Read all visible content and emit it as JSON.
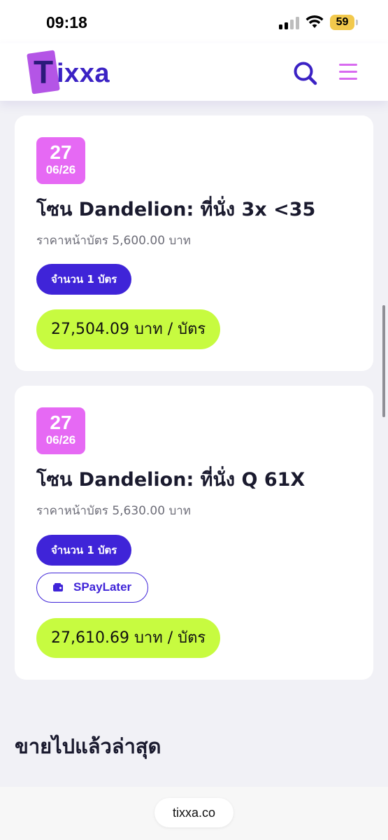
{
  "status_bar": {
    "time": "09:18",
    "battery": "59"
  },
  "header": {
    "logo_letter": "T",
    "logo_rest": "ixxa",
    "brand_colors": {
      "primary": "#3b22c4",
      "accent": "#d86bf0"
    }
  },
  "listings": [
    {
      "date_day": "27",
      "date_md": "06/26",
      "title": "โซน Dandelion: ที่นั่ง 3x <35",
      "face_price": "ราคาหน้าบัตร 5,600.00 บาท",
      "quantity": "จำนวน 1 บัตร",
      "price": "27,504.09 บาท / บัตร"
    },
    {
      "date_day": "27",
      "date_md": "06/26",
      "title": "โซน Dandelion: ที่นั่ง Q 61X",
      "face_price": "ราคาหน้าบัตร 5,630.00 บาท",
      "quantity": "จำนวน 1 บัตร",
      "paylater": "SPayLater",
      "price": "27,610.69 บาท / บัตร"
    }
  ],
  "section": {
    "recently_sold_title": "ขายไปแล้วล่าสุด"
  },
  "browser": {
    "url": "tixxa.co"
  },
  "colors": {
    "date_badge": "#e669f4",
    "quantity_pill": "#3f24d8",
    "price_pill": "#c7fb40"
  }
}
